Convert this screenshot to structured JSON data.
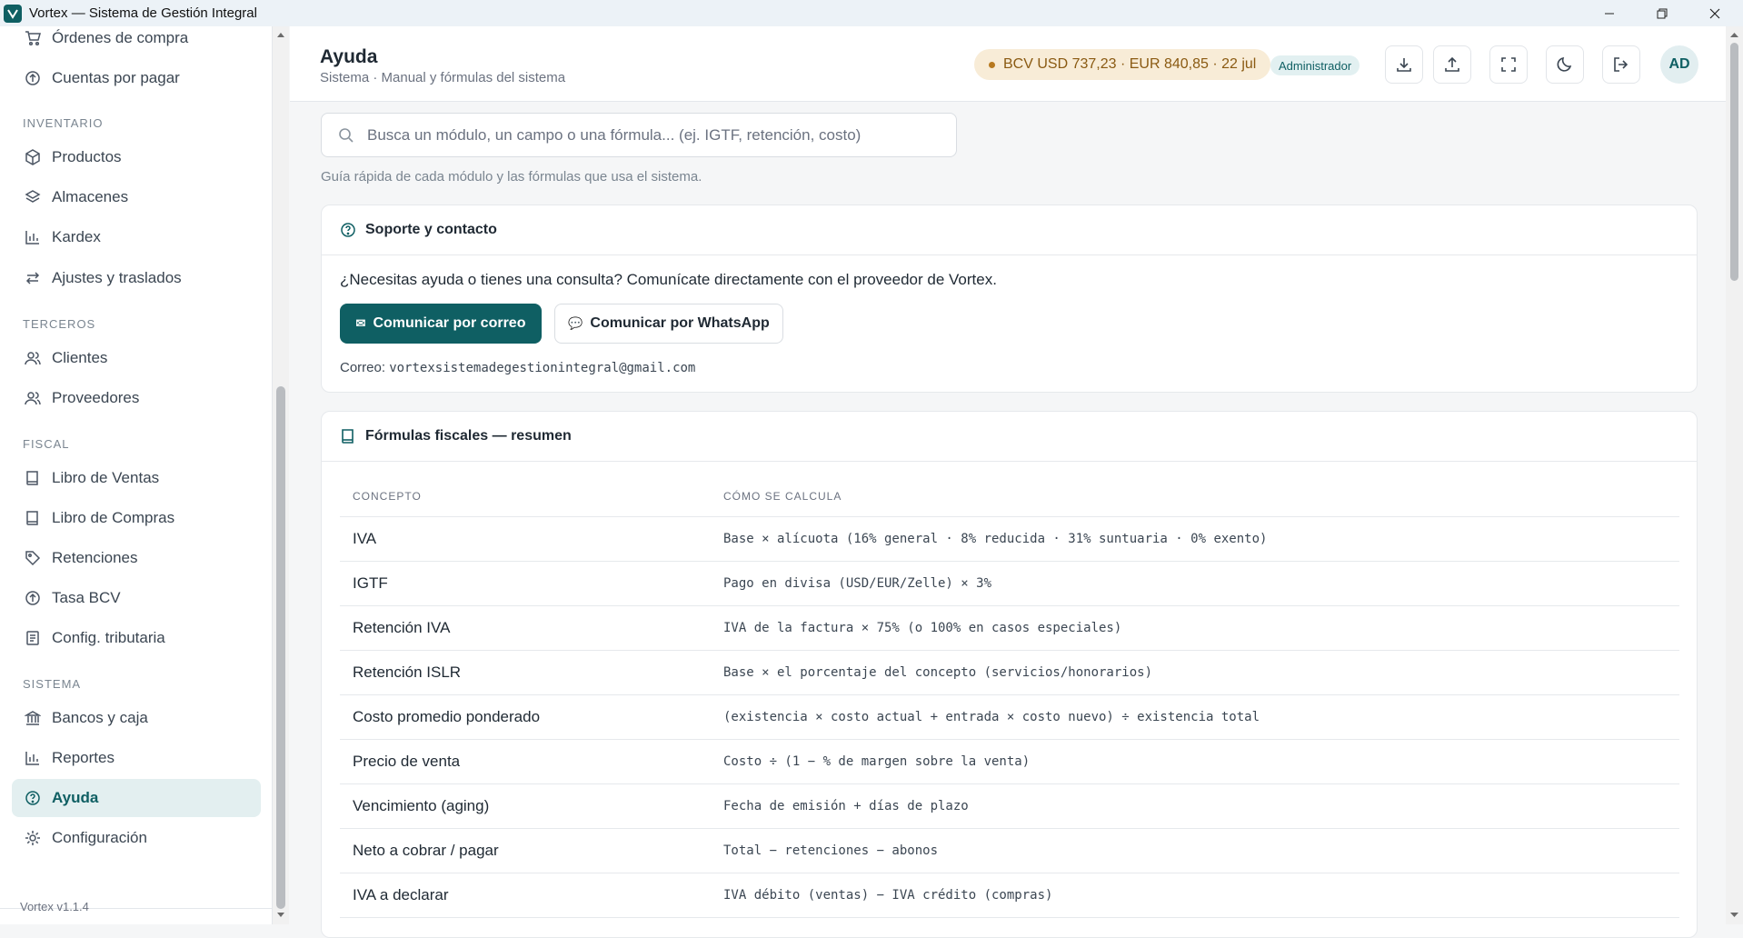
{
  "window": {
    "title": "Vortex — Sistema de Gestión Integral",
    "controls": [
      "minimize",
      "restore",
      "close"
    ]
  },
  "sidebar": {
    "items": [
      {
        "label": "Órdenes de compra",
        "icon": "cart-icon"
      },
      {
        "label": "Cuentas por pagar",
        "icon": "circle-arrow-icon"
      },
      {
        "label": "Productos",
        "icon": "box-icon"
      },
      {
        "label": "Almacenes",
        "icon": "layers-icon"
      },
      {
        "label": "Kardex",
        "icon": "bar-chart-icon"
      },
      {
        "label": "Ajustes y traslados",
        "icon": "arrows-icon"
      },
      {
        "label": "Clientes",
        "icon": "users-icon"
      },
      {
        "label": "Proveedores",
        "icon": "users-icon"
      },
      {
        "label": "Libro de Ventas",
        "icon": "book-icon"
      },
      {
        "label": "Libro de Compras",
        "icon": "book-icon"
      },
      {
        "label": "Retenciones",
        "icon": "tag-icon"
      },
      {
        "label": "Tasa BCV",
        "icon": "circle-arrow-icon"
      },
      {
        "label": "Config. tributaria",
        "icon": "document-icon"
      },
      {
        "label": "Bancos y caja",
        "icon": "bank-icon"
      },
      {
        "label": "Reportes",
        "icon": "bar-chart-icon"
      },
      {
        "label": "Ayuda",
        "icon": "help-icon",
        "active": true
      },
      {
        "label": "Configuración",
        "icon": "gear-icon"
      }
    ],
    "sections": {
      "inventario": "INVENTARIO",
      "terceros": "TERCEROS",
      "fiscal": "FISCAL",
      "sistema": "SISTEMA"
    },
    "version": "Vortex v1.1.4"
  },
  "header": {
    "title": "Ayuda",
    "subtitle": "Sistema · Manual y fórmulas del sistema",
    "rate": "BCV USD 737,23 · EUR 840,85 · 22 jul",
    "role": "Administrador",
    "avatar": "AD",
    "buttons": [
      "download-icon",
      "upload-icon",
      "fullscreen-icon",
      "moon-icon",
      "logout-icon"
    ]
  },
  "search": {
    "placeholder": "Busca un módulo, un campo o una fórmula... (ej. IGTF, retención, costo)",
    "value": ""
  },
  "hint": "Guía rápida de cada módulo y las fórmulas que usa el sistema.",
  "support": {
    "title": "Soporte y contacto",
    "text": "¿Necesitas ayuda o tienes una consulta? Comunícate directamente con el proveedor de Vortex.",
    "email_button": "Comunicar por correo",
    "whatsapp_button": "Comunicar por WhatsApp",
    "email_label": "Correo:",
    "email": "vortexsistemadegestionintegral@gmail.com"
  },
  "formulas": {
    "title": "Fórmulas fiscales — resumen",
    "columns": [
      "CONCEPTO",
      "CÓMO SE CALCULA"
    ],
    "rows": [
      {
        "concept": "IVA",
        "formula": "Base × alícuota (16% general · 8% reducida · 31% suntuaria · 0% exento)"
      },
      {
        "concept": "IGTF",
        "formula": "Pago en divisa (USD/EUR/Zelle) × 3%"
      },
      {
        "concept": "Retención IVA",
        "formula": "IVA de la factura × 75% (o 100% en casos especiales)"
      },
      {
        "concept": "Retención ISLR",
        "formula": "Base × el porcentaje del concepto (servicios/honorarios)"
      },
      {
        "concept": "Costo promedio ponderado",
        "formula": "(existencia × costo actual + entrada × costo nuevo) ÷ existencia total"
      },
      {
        "concept": "Precio de venta",
        "formula": "Costo ÷ (1 − % de margen sobre la venta)"
      },
      {
        "concept": "Vencimiento (aging)",
        "formula": "Fecha de emisión + días de plazo"
      },
      {
        "concept": "Neto a cobrar / pagar",
        "formula": "Total − retenciones − abonos"
      },
      {
        "concept": "IVA a declarar",
        "formula": "IVA débito (ventas) − IVA crédito (compras)"
      }
    ]
  }
}
